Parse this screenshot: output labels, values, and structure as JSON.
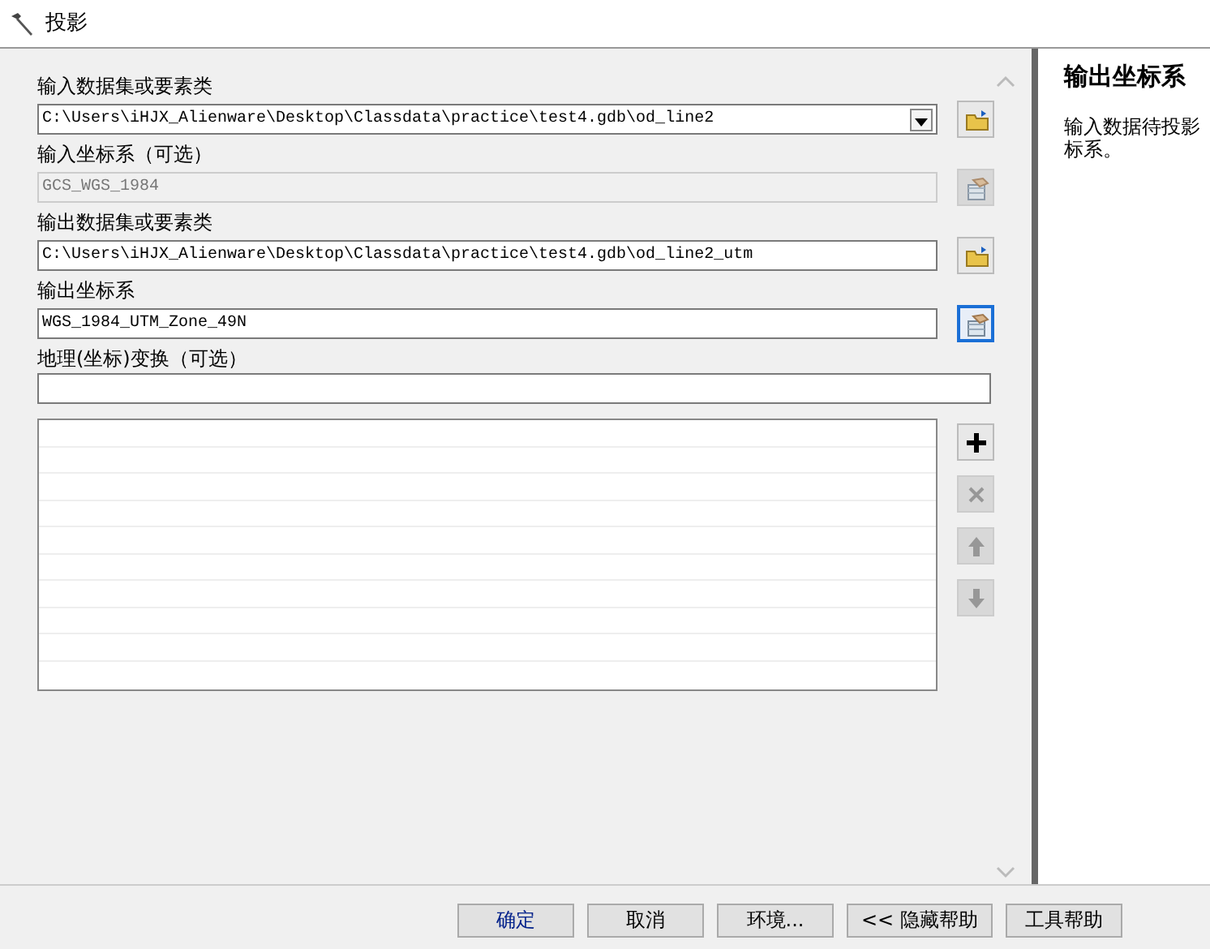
{
  "window": {
    "title": "投影"
  },
  "fields": [
    {
      "label": "输入数据集或要素类",
      "kind": "combo",
      "value": "C:\\Users\\iHJX_Alienware\\Desktop\\Classdata\\practice\\test4.gdb\\od_line2",
      "disabled": false,
      "button": {
        "kind": "folder",
        "focused": false
      }
    },
    {
      "label": "输入坐标系（可选）",
      "kind": "text",
      "value": "GCS_WGS_1984",
      "disabled": true,
      "button": {
        "kind": "coord",
        "focused": false
      }
    },
    {
      "label": "输出数据集或要素类",
      "kind": "text",
      "value": "C:\\Users\\iHJX_Alienware\\Desktop\\Classdata\\practice\\test4.gdb\\od_line2_utm",
      "disabled": false,
      "button": {
        "kind": "folder",
        "focused": false
      }
    },
    {
      "label": "输出坐标系",
      "kind": "text",
      "value": "WGS_1984_UTM_Zone_49N",
      "disabled": false,
      "button": {
        "kind": "coord",
        "focused": true
      }
    },
    {
      "label": "地理(坐标)变换（可选）",
      "kind": "text",
      "disabled": false
    }
  ],
  "transform_list": {
    "tools": [
      {
        "kind": "add",
        "disabled": false
      },
      {
        "kind": "remove",
        "disabled": true
      },
      {
        "kind": "up",
        "disabled": true
      },
      {
        "kind": "down",
        "disabled": true
      }
    ]
  },
  "help": {
    "title": "输出坐标系",
    "lines": [
      "输入数据待投影",
      "标系。"
    ]
  },
  "buttons": [
    "确定",
    "取消",
    "环境...",
    "<< 隐藏帮助",
    "工具帮助"
  ]
}
